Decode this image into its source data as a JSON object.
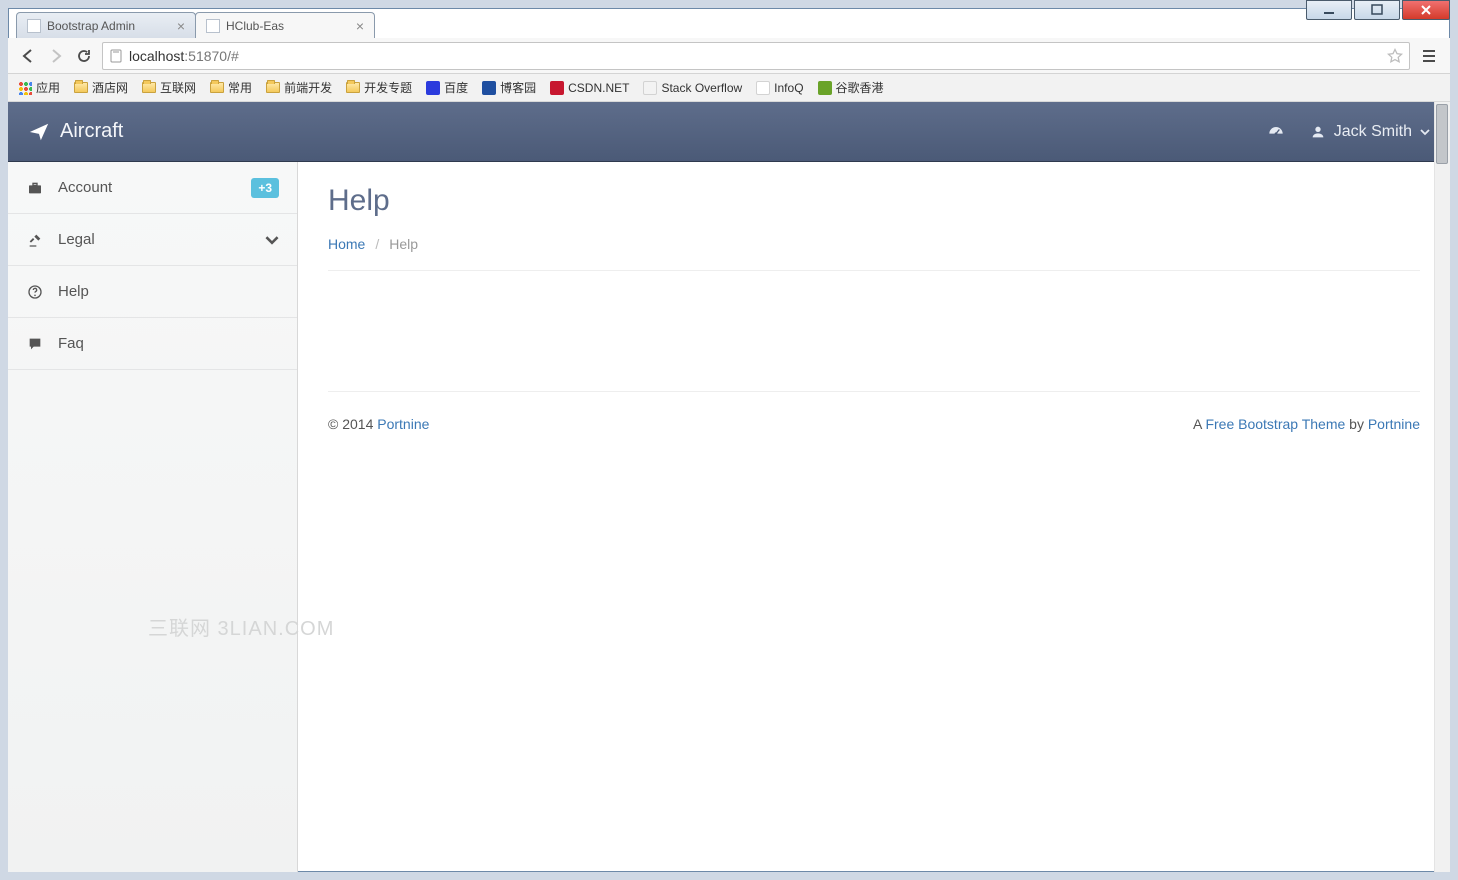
{
  "browser": {
    "tabs": [
      {
        "title": "Bootstrap Admin",
        "active": false
      },
      {
        "title": "HClub-Eas",
        "active": true
      }
    ],
    "url_host": "localhost",
    "url_port": ":51870/#",
    "bookmarks": [
      {
        "label": "应用",
        "kind": "apps"
      },
      {
        "label": "酒店网",
        "kind": "folder"
      },
      {
        "label": "互联网",
        "kind": "folder"
      },
      {
        "label": "常用",
        "kind": "folder"
      },
      {
        "label": "前端开发",
        "kind": "folder"
      },
      {
        "label": "开发专题",
        "kind": "folder"
      },
      {
        "label": "百度",
        "kind": "site",
        "color": "#2b3bdd"
      },
      {
        "label": "博客园",
        "kind": "site",
        "color": "#1f4fa0"
      },
      {
        "label": "CSDN.NET",
        "kind": "site",
        "color": "#c7172f"
      },
      {
        "label": "Stack Overflow",
        "kind": "site",
        "color": "#d99a3a"
      },
      {
        "label": "InfoQ",
        "kind": "site",
        "color": "#6aa329"
      },
      {
        "label": "谷歌香港",
        "kind": "site",
        "color": "#6aa329"
      }
    ]
  },
  "app": {
    "brand": "Aircraft",
    "user_name": "Jack Smith",
    "sidebar": [
      {
        "icon": "briefcase",
        "label": "Account",
        "badge": "+3"
      },
      {
        "icon": "gavel",
        "label": "Legal",
        "chevron": true
      },
      {
        "icon": "help",
        "label": "Help"
      },
      {
        "icon": "comment",
        "label": "Faq"
      }
    ],
    "page_title": "Help",
    "breadcrumb": {
      "home": "Home",
      "current": "Help"
    },
    "footer": {
      "copyright": "© 2014 ",
      "copyright_link": "Portnine",
      "right_prefix": "A ",
      "theme_link": "Free Bootstrap Theme",
      "by": " by ",
      "author_link": "Portnine"
    },
    "watermark": "三联网 3LIAN.COM"
  }
}
